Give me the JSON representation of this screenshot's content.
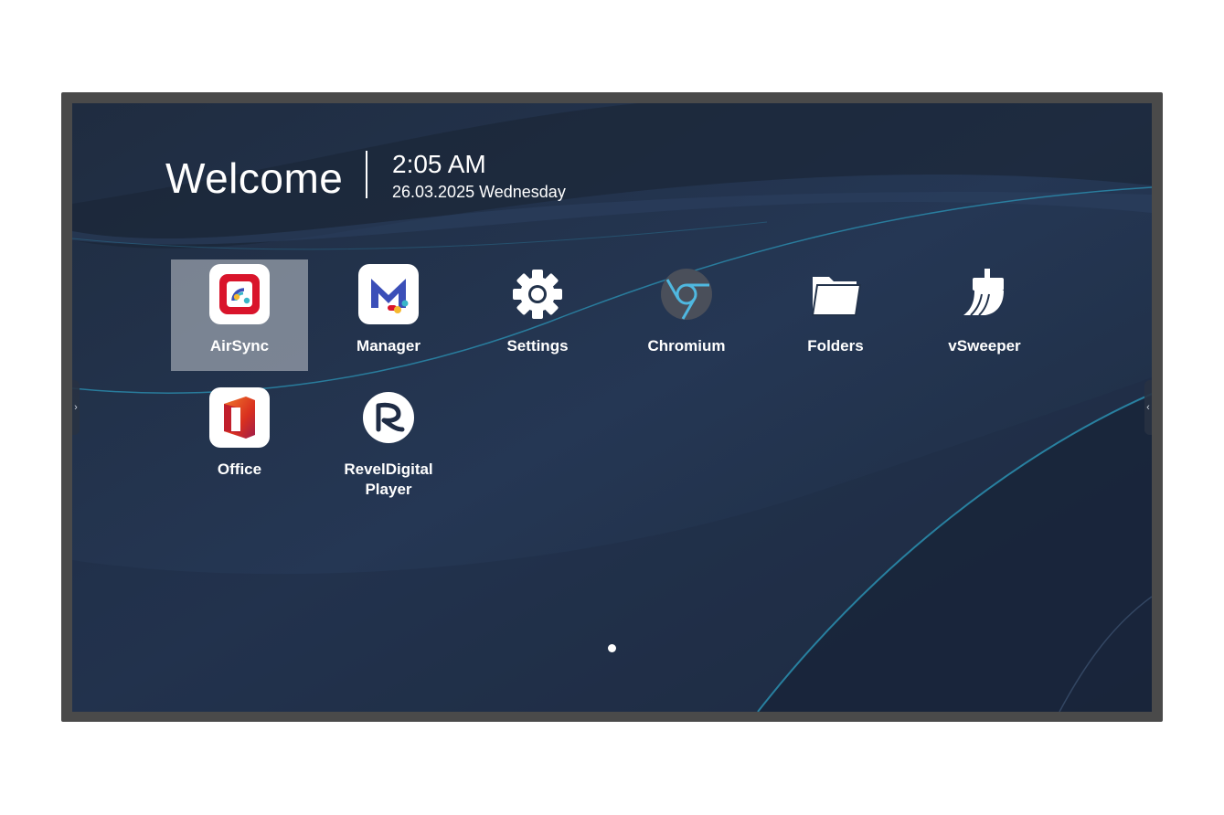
{
  "header": {
    "welcome": "Welcome",
    "time": "2:05 AM",
    "date": "26.03.2025 Wednesday"
  },
  "apps": [
    {
      "label": "AirSync",
      "icon": "airsync-icon",
      "selected": true
    },
    {
      "label": "Manager",
      "icon": "manager-icon"
    },
    {
      "label": "Settings",
      "icon": "gear-icon"
    },
    {
      "label": "Chromium",
      "icon": "chromium-icon"
    },
    {
      "label": "Folders",
      "icon": "folder-icon"
    },
    {
      "label": "vSweeper",
      "icon": "broom-icon"
    },
    {
      "label": "Office",
      "icon": "office-icon"
    },
    {
      "label": "ReveIDigital Player",
      "line1": "RevelDigital",
      "line2": "Player",
      "icon": "reveldigital-icon"
    }
  ],
  "edge_handles": {
    "left": "›",
    "right": "‹"
  },
  "pager": {
    "current_page": 1,
    "page_count": 1
  },
  "colors": {
    "wallpaper": "#22324a",
    "accent_line": "#2a8fb0",
    "selection": "#a9aeb8",
    "airsync_red": "#d9142b",
    "manager_blue": "#3b4fb8"
  }
}
